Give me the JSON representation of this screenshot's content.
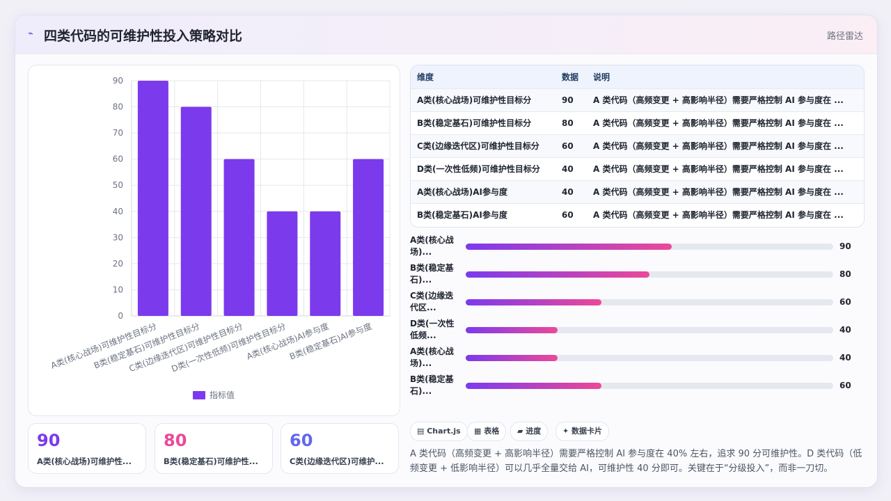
{
  "header": {
    "icon": "⌁",
    "title": "四类代码的可维护性投入策略对比",
    "nav_label": "路径雷达"
  },
  "chart_data": {
    "type": "bar",
    "categories": [
      "A类(核心战场)可维护性目标分",
      "B类(稳定基石)可维护性目标分",
      "C类(边缘迭代区)可维护性目标分",
      "D类(一次性低频)可维护性目标分",
      "A类(核心战场)AI参与度",
      "B类(稳定基石)AI参与度"
    ],
    "series": [
      {
        "name": "指标值",
        "values": [
          90,
          80,
          60,
          40,
          40,
          60
        ]
      }
    ],
    "ylim": [
      0,
      90
    ],
    "yticks": [
      0,
      10,
      20,
      30,
      40,
      50,
      60,
      70,
      80,
      90
    ],
    "color": "#7c3aed",
    "legend": "bottom",
    "grid": true
  },
  "stats": [
    {
      "value": "90",
      "label": "A类(核心战场)可维护性...",
      "color": "#7c3aed"
    },
    {
      "value": "80",
      "label": "B类(稳定基石)可维护性...",
      "color": "#ec4899"
    },
    {
      "value": "60",
      "label": "C类(边缘迭代区)可维护...",
      "color": "#6366f1"
    }
  ],
  "table": {
    "headers": [
      "维度",
      "数据",
      "说明"
    ],
    "rows": [
      [
        "A类(核心战场)可维护性目标分",
        "90",
        "A 类代码（高频变更 + 高影响半径）需要严格控制 AI 参与度在 ..."
      ],
      [
        "B类(稳定基石)可维护性目标分",
        "80",
        "A 类代码（高频变更 + 高影响半径）需要严格控制 AI 参与度在 ..."
      ],
      [
        "C类(边缘迭代区)可维护性目标分",
        "60",
        "A 类代码（高频变更 + 高影响半径）需要严格控制 AI 参与度在 ..."
      ],
      [
        "D类(一次性低频)可维护性目标分",
        "40",
        "A 类代码（高频变更 + 高影响半径）需要严格控制 AI 参与度在 ..."
      ],
      [
        "A类(核心战场)AI参与度",
        "40",
        "A 类代码（高频变更 + 高影响半径）需要严格控制 AI 参与度在 ..."
      ],
      [
        "B类(稳定基石)AI参与度",
        "60",
        "A 类代码（高频变更 + 高影响半径）需要严格控制 AI 参与度在 ..."
      ]
    ]
  },
  "progress": [
    {
      "label": "A类(核心战场)...",
      "value": "90",
      "fraction": 0.56
    },
    {
      "label": "B类(稳定基石)...",
      "value": "80",
      "fraction": 0.5
    },
    {
      "label": "C类(边缘迭代区...",
      "value": "60",
      "fraction": 0.37
    },
    {
      "label": "D类(一次性低频...",
      "value": "40",
      "fraction": 0.25
    },
    {
      "label": "A类(核心战场)...",
      "value": "40",
      "fraction": 0.25
    },
    {
      "label": "B类(稳定基石)...",
      "value": "60",
      "fraction": 0.37
    }
  ],
  "tags": [
    "▤ Chart.js",
    "▦ 表格",
    "▰ 进度",
    "✦ 数据卡片"
  ],
  "summary": "A 类代码（高频变更 + 高影响半径）需要严格控制 AI 参与度在 40% 左右，追求 90 分可维护性。D 类代码（低频变更 + 低影响半径）可以几乎全量交给 AI，可维护性 40 分即可。关键在于“分级投入”，而非一刀切。"
}
